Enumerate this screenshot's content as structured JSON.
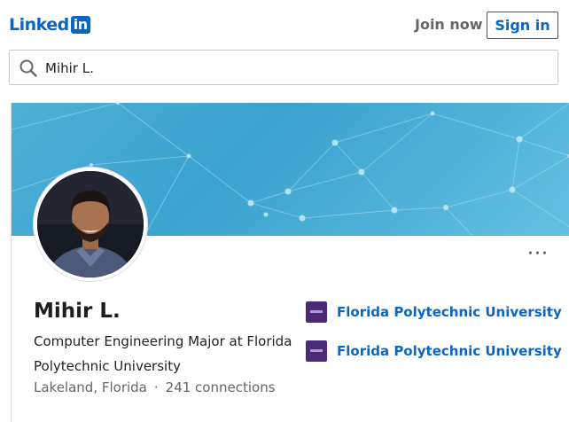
{
  "header": {
    "logo_text": "Linked",
    "logo_box": "in",
    "join_label": "Join now",
    "signin_label": "Sign in"
  },
  "search": {
    "value": "Mihir L."
  },
  "profile": {
    "name": "Mihir L.",
    "headline": "Computer Engineering Major at Florida Polytechnic University",
    "location": "Lakeland, Florida",
    "separator": "·",
    "connections": "241 connections",
    "more_label": "···"
  },
  "education": [
    {
      "name": "Florida Polytechnic University"
    },
    {
      "name": "Florida Polytechnic University"
    }
  ],
  "colors": {
    "brand": "#0a66c2",
    "banner": "#4fb0d6"
  }
}
